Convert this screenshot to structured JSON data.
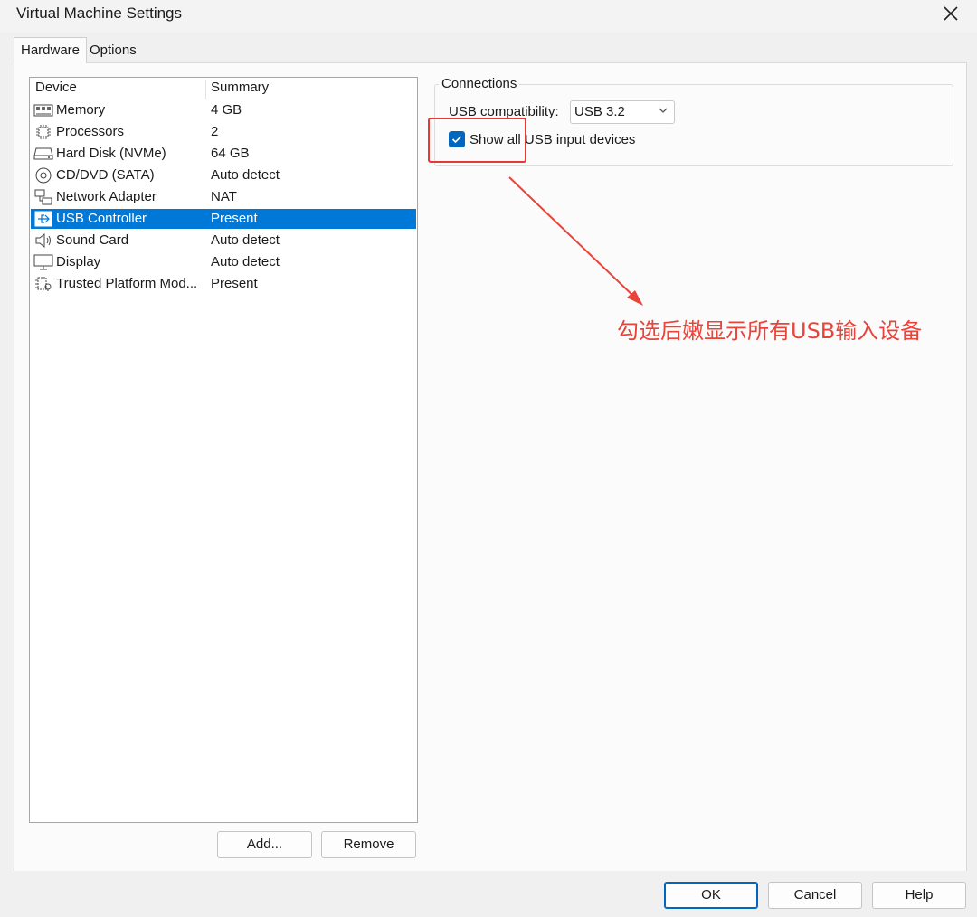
{
  "window": {
    "title": "Virtual Machine Settings"
  },
  "tabs": [
    {
      "label": "Hardware",
      "active": true
    },
    {
      "label": "Options",
      "active": false
    }
  ],
  "device_list": {
    "columns": [
      "Device",
      "Summary"
    ],
    "rows": [
      {
        "icon": "memory-icon",
        "name": "Memory",
        "summary": "4 GB",
        "selected": false
      },
      {
        "icon": "processor-icon",
        "name": "Processors",
        "summary": "2",
        "selected": false
      },
      {
        "icon": "hard-disk-icon",
        "name": "Hard Disk (NVMe)",
        "summary": "64 GB",
        "selected": false
      },
      {
        "icon": "cd-dvd-icon",
        "name": "CD/DVD (SATA)",
        "summary": "Auto detect",
        "selected": false
      },
      {
        "icon": "network-adapter-icon",
        "name": "Network Adapter",
        "summary": "NAT",
        "selected": false
      },
      {
        "icon": "usb-icon",
        "name": "USB Controller",
        "summary": "Present",
        "selected": true
      },
      {
        "icon": "speaker-icon",
        "name": "Sound Card",
        "summary": "Auto detect",
        "selected": false
      },
      {
        "icon": "display-icon",
        "name": "Display",
        "summary": "Auto detect",
        "selected": false
      },
      {
        "icon": "tpm-icon",
        "name": "Trusted Platform Mod...",
        "summary": "Present",
        "selected": false
      }
    ]
  },
  "list_buttons": {
    "add": "Add...",
    "remove": "Remove"
  },
  "connections": {
    "group_label": "Connections",
    "usb_compat_label": "USB compatibility:",
    "usb_compat_value": "USB 3.2",
    "show_all_label": "Show all USB input devices",
    "show_all_checked": true
  },
  "annotation": {
    "text": "勾选后嫩显示所有USB输入设备",
    "color": "#e8443a"
  },
  "footer": {
    "ok": "OK",
    "cancel": "Cancel",
    "help": "Help"
  },
  "colors": {
    "selection": "#0078d7",
    "accent": "#0067c0",
    "annotation_red": "#e53935"
  }
}
